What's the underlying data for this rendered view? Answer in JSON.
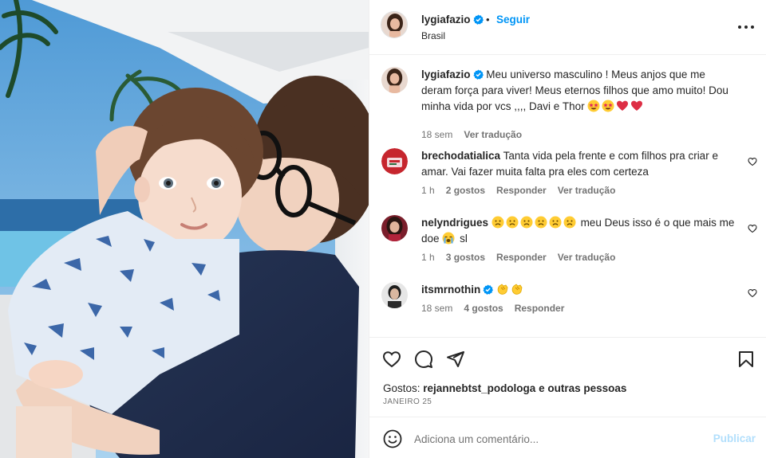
{
  "post": {
    "author": {
      "username": "lygiafazio",
      "verified": true,
      "follow_label": "Seguir",
      "separator": "•",
      "location": "Brasil"
    },
    "caption": {
      "username": "lygiafazio",
      "text": "Meu universo masculino ! Meus anjos que me deram força para viver! Meus eternos filhos que amo muito! Dou minha vida por vcs ,,,, Davi e Thor",
      "emojis": [
        "star-struck-emoji",
        "star-struck-emoji",
        "red-heart-emoji",
        "red-heart-emoji"
      ],
      "time": "18 sem",
      "translate_label": "Ver tradução"
    },
    "comments": [
      {
        "username": "brechodatialica",
        "text": "Tanta vida pela frente e com filhos pra criar e amar. Vai fazer muita falta pra eles com certeza",
        "time": "1 h",
        "likes": "2 gostos",
        "reply_label": "Responder",
        "translate_label": "Ver tradução"
      },
      {
        "username": "nelyndrigues",
        "text_before_emoji": "meu Deus isso é o que mais me doe",
        "text_after_emoji": "sl",
        "leading_emojis": [
          "frowning-face-emoji",
          "frowning-face-emoji",
          "frowning-face-emoji",
          "frowning-face-emoji",
          "frowning-face-emoji",
          "frowning-face-emoji"
        ],
        "inline_emoji": "loudly-crying-face-emoji",
        "time": "1 h",
        "likes": "3 gostos",
        "reply_label": "Responder",
        "translate_label": "Ver tradução"
      },
      {
        "username": "itsmrnothin",
        "verified": true,
        "emojis": [
          "clapping-hands-emoji",
          "clapping-hands-emoji"
        ],
        "time": "18 sem",
        "likes": "4 gostos",
        "reply_label": "Responder"
      }
    ],
    "likes_prefix": "Gostos:",
    "likes_user": "rejannebtst_podologa",
    "likes_suffix": "e outras pessoas",
    "date": "JANEIRO 25",
    "comment_placeholder": "Adiciona um comentário...",
    "publish_label": "Publicar",
    "icons": {
      "like": "heart-icon",
      "comment": "comment-bubble-icon",
      "share": "paper-plane-icon",
      "save": "bookmark-icon",
      "more": "more-options-icon",
      "emoji": "smiley-icon"
    },
    "colors": {
      "link_blue": "#0095f6",
      "publish_disabled": "#b2dffc",
      "meta_gray": "#737373",
      "verified_blue": "#0095f6"
    }
  }
}
